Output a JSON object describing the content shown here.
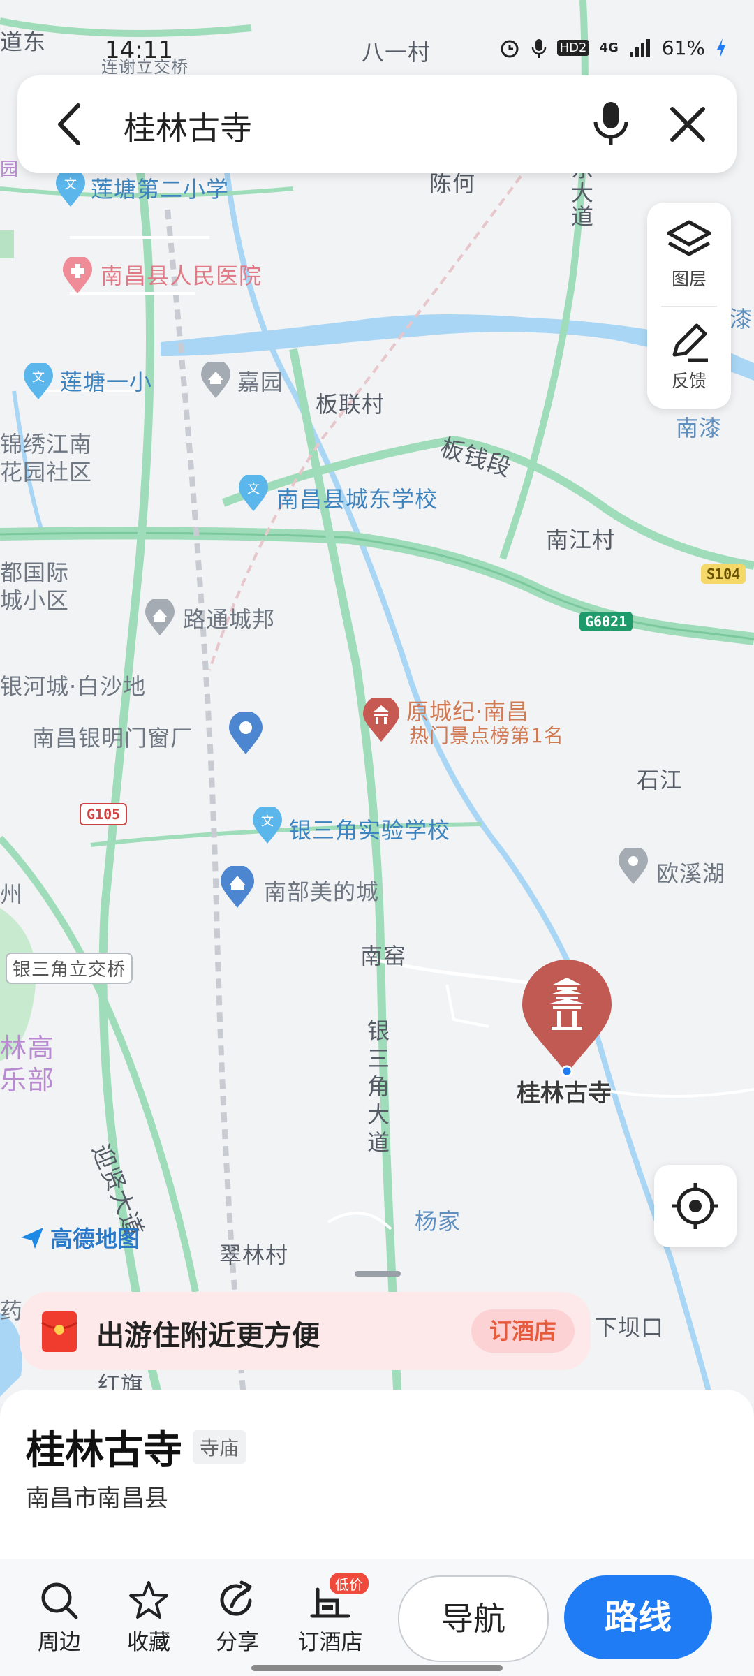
{
  "status_bar": {
    "time": "14:11",
    "battery": "61%",
    "network": "4G",
    "hd_label": "HD2"
  },
  "search": {
    "query": "桂林古寺"
  },
  "tools": {
    "layers": "图层",
    "feedback": "反馈"
  },
  "map": {
    "labels": {
      "lianxie_bridge": "连谢立交桥",
      "bayi": "八一村",
      "daodong": "道东",
      "chen": "陈何",
      "lt2": "莲塘第二小学",
      "hospital": "南昌县人民医院",
      "lt1": "莲塘一小",
      "jiayuan": "嘉园",
      "banlian": "板联村",
      "jinxiu": "锦绣江南\n花园社区",
      "banqian": "板钱段",
      "chengdong": "南昌县城东学校",
      "nanqi": "南漆",
      "qi": "漆",
      "nanjiang": "南江村",
      "dushi": "都国际\n城小区",
      "lutong": "路通城邦",
      "yinhecheng": "银河城·白沙地",
      "yuancheng": "原城纪·南昌",
      "hot": "热门景点榜第1名",
      "yinming": "南昌银明门窗厂",
      "shijiang": "石江",
      "sanjiao_school": "银三角实验学校",
      "nanbu": "南部美的城",
      "ouxi": "欧溪湖",
      "zhou": "州",
      "nanyao": "南窑",
      "bridge": "银三角立交桥",
      "linggao": "林高\n乐部",
      "ysj_road": "银\n三\n角\n大\n道",
      "yingxian": "迎贤大道",
      "yangjia": "杨家",
      "cuilin": "翠林村",
      "amap": "高德地图",
      "xiaba": "下坝口",
      "dongdadao": "东\n大\n道",
      "hongqi": "红旗",
      "yao": "药",
      "yuan": "园"
    },
    "shields": {
      "s104": "S104",
      "g6021": "G6021",
      "g105": "G105"
    },
    "poi_marker_label": "桂林古寺"
  },
  "promo": {
    "text": "出游住附近更方便",
    "button": "订酒店"
  },
  "place": {
    "name": "桂林古寺",
    "category": "寺庙",
    "address": "南昌市南昌县"
  },
  "actions": {
    "nearby": "周边",
    "favorite": "收藏",
    "share": "分享",
    "hotel": "订酒店",
    "hotel_badge": "低价",
    "navigate": "导航",
    "route": "路线"
  },
  "colors": {
    "road_green": "#9fdcb9",
    "river": "#9cd0f3",
    "accent_blue": "#1f7cf4",
    "marker_red": "#c25a54"
  }
}
